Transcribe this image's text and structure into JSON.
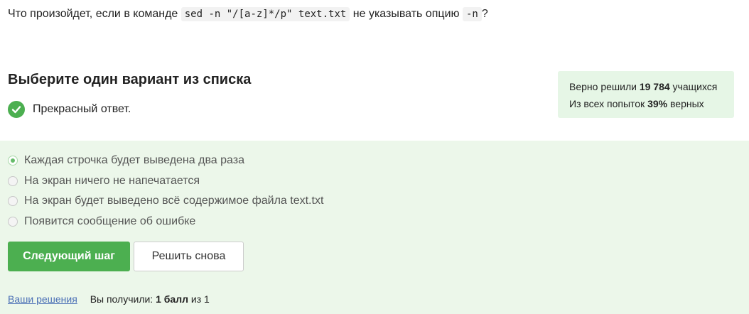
{
  "question": {
    "part1": "Что произойдет, если в команде ",
    "code1": "sed -n \"/[a-z]*/p\" text.txt",
    "part2": " не указывать опцию ",
    "code2": "-n",
    "part3": "?"
  },
  "section_title": "Выберите один вариант из списка",
  "feedback": {
    "text": "Прекрасный ответ.",
    "icon": "check-circle-icon",
    "color": "#4caf50"
  },
  "stats": {
    "line1_prefix": "Верно решили ",
    "line1_value": "19 784",
    "line1_suffix": " учащихся",
    "line2_prefix": "Из всех попыток ",
    "line2_value": "39%",
    "line2_suffix": " верных"
  },
  "options": [
    {
      "label": "Каждая строчка будет выведена два раза",
      "selected": true
    },
    {
      "label": "На экран ничего не напечатается",
      "selected": false
    },
    {
      "label": "На экран будет выведено всё содержимое файла text.txt",
      "selected": false
    },
    {
      "label": "Появится сообщение об ошибке",
      "selected": false
    }
  ],
  "buttons": {
    "next": "Следующий шаг",
    "retry": "Решить снова"
  },
  "footer": {
    "link": "Ваши решения",
    "score_prefix": "Вы получили: ",
    "score_value": "1 балл",
    "score_suffix": " из 1"
  },
  "colors": {
    "accent": "#4caf50",
    "answer_bg": "#ecf7ea",
    "stats_bg": "#e6f6e6",
    "link": "#4a6fb5"
  }
}
